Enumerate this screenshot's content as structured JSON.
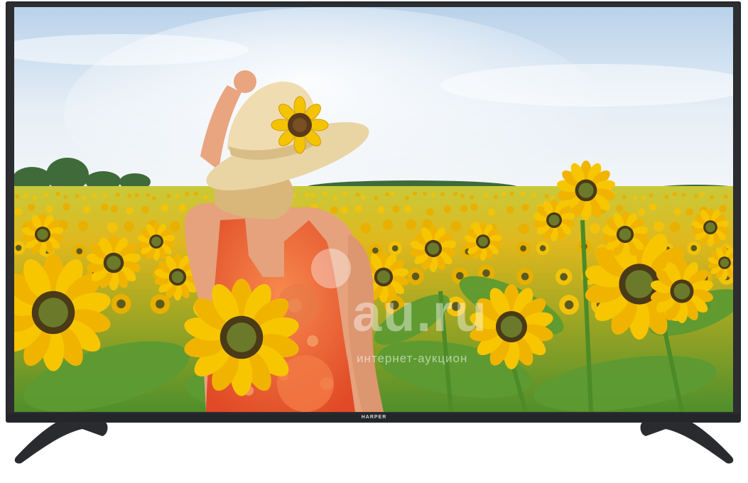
{
  "product": {
    "brand_logo": "HARPER"
  },
  "watermark": {
    "logo": "au.ru",
    "tagline": "интернет-аукцион"
  },
  "colors": {
    "bezel": "#2c2d30",
    "sky": "#cfe0ef",
    "sunflower_petal": "#f5c400",
    "leaf": "#6aa63a",
    "dress": "#f0653a",
    "hat": "#e8d6a8"
  }
}
